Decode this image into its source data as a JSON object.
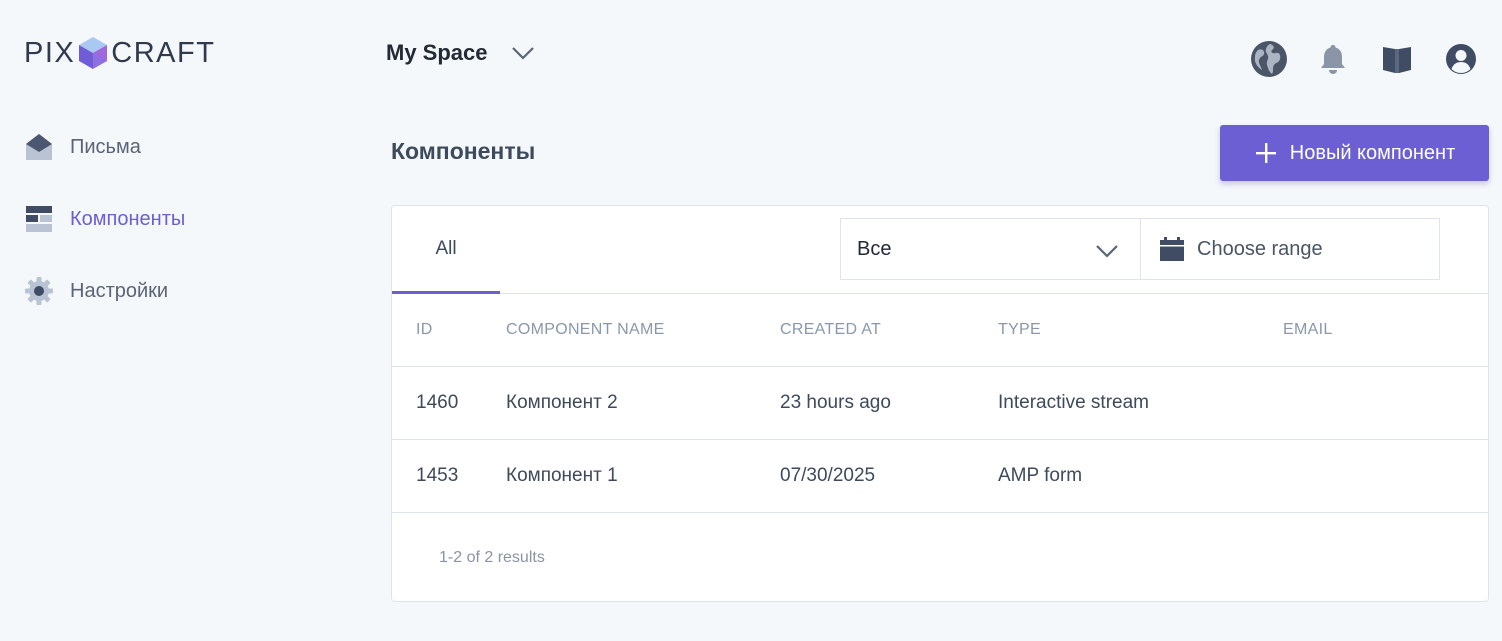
{
  "brand": {
    "left": "PIX",
    "right": "CRAFT"
  },
  "space": {
    "label": "My Space"
  },
  "top_icons": [
    "globe-icon",
    "bell-icon",
    "book-icon",
    "user-icon"
  ],
  "sidebar": {
    "items": [
      {
        "label": "Письма",
        "icon": "envelope-icon",
        "active": false
      },
      {
        "label": "Компоненты",
        "icon": "components-icon",
        "active": true
      },
      {
        "label": "Настройки",
        "icon": "gear-icon",
        "active": false
      }
    ]
  },
  "page": {
    "title": "Компоненты",
    "new_button": "Новый компонент"
  },
  "filters": {
    "tab": "All",
    "select_value": "Все",
    "range_placeholder": "Choose range"
  },
  "table": {
    "headers": [
      "ID",
      "COMPONENT NAME",
      "CREATED AT",
      "TYPE",
      "EMAIL"
    ],
    "rows": [
      {
        "id": "1460",
        "name": "Компонент 2",
        "created": "23 hours ago",
        "type": "Interactive stream",
        "email": ""
      },
      {
        "id": "1453",
        "name": "Компонент 1",
        "created": "07/30/2025",
        "type": "AMP form",
        "email": ""
      }
    ],
    "results": "1-2 of 2 results"
  },
  "colors": {
    "accent": "#6b5fd3",
    "background": "#f5f8fb",
    "text": "#3d4a5c",
    "muted": "#8a97ac"
  }
}
